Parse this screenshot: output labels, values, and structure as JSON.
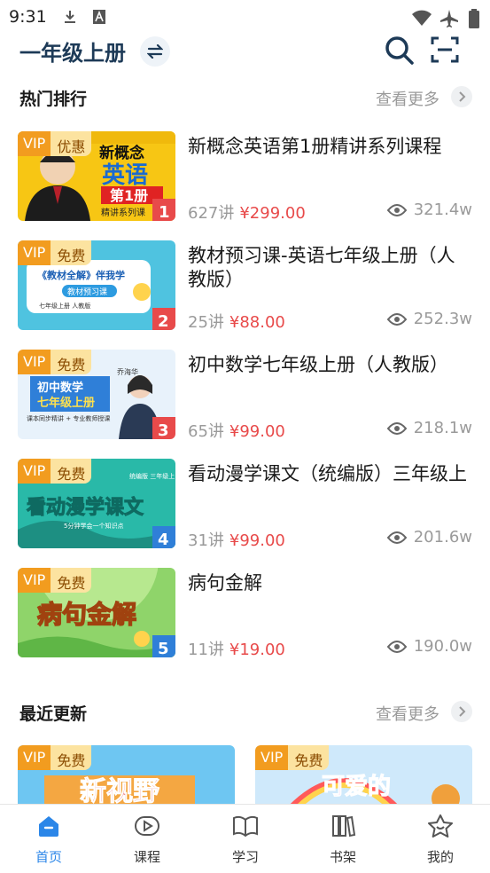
{
  "status_bar": {
    "time": "9:31"
  },
  "header": {
    "title": "一年级上册"
  },
  "hot": {
    "title": "热门排行",
    "more": "查看更多",
    "items": [
      {
        "title": "新概念英语第1册精讲系列课程",
        "vip": "VIP",
        "tag": "优惠",
        "lessons": "627讲",
        "price": "¥299.00",
        "views": "321.4w",
        "rank": "1",
        "thumb_text": [
          "新概念",
          "英语",
          "第1册",
          "精讲系列课"
        ]
      },
      {
        "title": "教材预习课-英语七年级上册（人教版）",
        "vip": "VIP",
        "tag": "免费",
        "lessons": "25讲",
        "price": "¥88.00",
        "views": "252.3w",
        "rank": "2",
        "thumb_text": [
          "《教材全解》伴我学",
          "教材预习课",
          "七年级上册  人教版"
        ]
      },
      {
        "title": "初中数学七年级上册（人教版）",
        "vip": "VIP",
        "tag": "免费",
        "lessons": "65讲",
        "price": "¥99.00",
        "views": "218.1w",
        "rank": "3",
        "thumb_text": [
          "初中数学",
          "七年级上册",
          "课本同步精讲 + 专业教师授课",
          "乔海华"
        ]
      },
      {
        "title": "看动漫学课文（统编版）三年级上",
        "vip": "VIP",
        "tag": "免费",
        "lessons": "31讲",
        "price": "¥99.00",
        "views": "201.6w",
        "rank": "4",
        "thumb_text": [
          "看动漫学课文",
          "统编版 三年级上",
          "5分钟学会一个知识点"
        ]
      },
      {
        "title": "病句金解",
        "vip": "VIP",
        "tag": "免费",
        "lessons": "11讲",
        "price": "¥19.00",
        "views": "190.0w",
        "rank": "5",
        "thumb_text": [
          "病句金解"
        ]
      }
    ]
  },
  "recent": {
    "title": "最近更新",
    "more": "查看更多",
    "cards": [
      {
        "vip": "VIP",
        "tag": "免费",
        "thumb_text": "新视野"
      },
      {
        "vip": "VIP",
        "tag": "免费",
        "thumb_text": "可爱的"
      }
    ]
  },
  "tabs": [
    {
      "label": "首页",
      "icon": "home-icon",
      "active": true
    },
    {
      "label": "课程",
      "icon": "play-icon"
    },
    {
      "label": "学习",
      "icon": "book-open-icon"
    },
    {
      "label": "书架",
      "icon": "bookshelf-icon"
    },
    {
      "label": "我的",
      "icon": "star-icon"
    }
  ],
  "colors": {
    "accent": "#2b86e8",
    "price": "#e84a4a",
    "vip": "#f29c1f",
    "title": "#1d3a57"
  }
}
